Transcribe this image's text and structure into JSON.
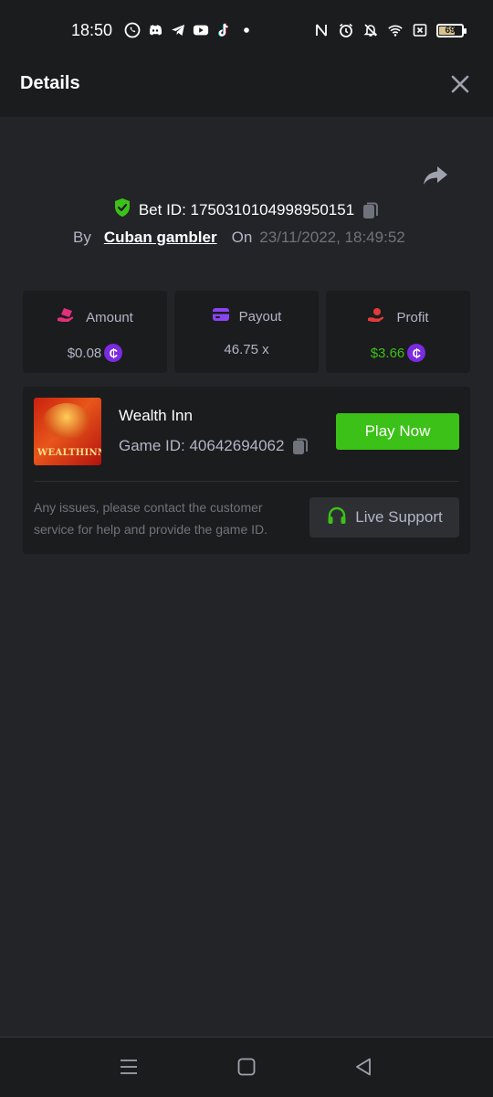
{
  "status_bar": {
    "time": "18:50",
    "battery": "69",
    "battery_level": 0.69,
    "app_icons": [
      "whatsapp-icon",
      "discord-icon",
      "telegram-icon",
      "youtube-icon",
      "tiktok-icon",
      "dot-icon"
    ],
    "system_icons": [
      "nfc-icon",
      "alarm-icon",
      "mute-icon",
      "wifi-icon",
      "close-box-icon",
      "battery-icon"
    ]
  },
  "header": {
    "title": "Details"
  },
  "bet": {
    "id_label": "Bet ID: 1750310104998950151",
    "by_label": "By",
    "user": "Cuban gambler",
    "on_label": "On",
    "date": "23/11/2022, 18:49:52"
  },
  "stats": {
    "amount": {
      "label": "Amount",
      "value": "$0.08"
    },
    "payout": {
      "label": "Payout",
      "value": "46.75 x"
    },
    "profit": {
      "label": "Profit",
      "value": "$3.66"
    }
  },
  "game": {
    "name": "Wealth Inn",
    "id_label": "Game ID: 40642694062",
    "thumbnail_text": "WEALTHINN",
    "play_label": "Play Now",
    "support_text": "Any issues, please contact the customer service for help and provide the game ID.",
    "support_label": "Live Support"
  },
  "colors": {
    "background": "#232427",
    "panel": "#1b1c1e",
    "green": "#3bc117",
    "muted": "#b1b6c6",
    "dim": "#6f737b",
    "coin": "#7b2be0"
  }
}
